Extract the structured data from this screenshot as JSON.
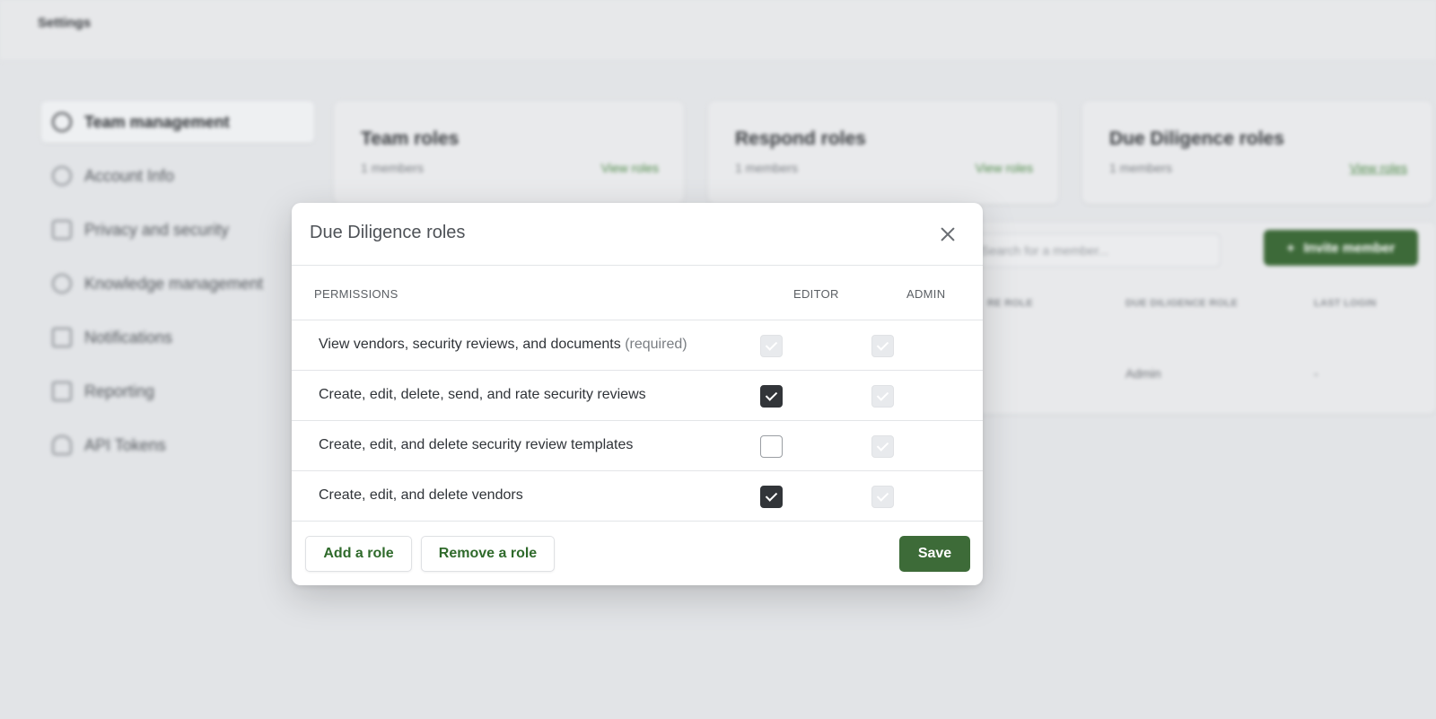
{
  "page": {
    "title": "Settings"
  },
  "sidebar": {
    "items": [
      {
        "label": "Team management",
        "icon": "users-icon"
      },
      {
        "label": "Account Info",
        "icon": "user-icon"
      },
      {
        "label": "Privacy and security",
        "icon": "lock-icon"
      },
      {
        "label": "Knowledge management",
        "icon": "globe-icon"
      },
      {
        "label": "Notifications",
        "icon": "notification-icon"
      },
      {
        "label": "Reporting",
        "icon": "report-icon"
      },
      {
        "label": "API Tokens",
        "icon": "cloud-icon"
      }
    ]
  },
  "cards": [
    {
      "title": "Team roles",
      "members": "1 members",
      "link": "View roles"
    },
    {
      "title": "Respond roles",
      "members": "1 members",
      "link": "View roles"
    },
    {
      "title": "Due Diligence roles",
      "members": "1 members",
      "link": "View roles"
    }
  ],
  "team_panel": {
    "search_placeholder": "Search for a member...",
    "invite_label": "Invite member",
    "columns": [
      "RE ROLE",
      "DUE DILIGENCE ROLE",
      "LAST LOGIN"
    ],
    "row": {
      "due_diligence_role": "Admin",
      "last_login": "-"
    }
  },
  "modal": {
    "title": "Due Diligence roles",
    "headers": {
      "permissions": "PERMISSIONS",
      "editor": "EDITOR",
      "admin": "ADMIN"
    },
    "permissions": [
      {
        "label": "View vendors, security reviews, and documents",
        "suffix": "(required)",
        "editor": "disabled-checked",
        "admin": "disabled-checked"
      },
      {
        "label": "Create, edit, delete, send, and rate security reviews",
        "suffix": "",
        "editor": "checked",
        "admin": "disabled-checked"
      },
      {
        "label": "Create, edit, and delete security review templates",
        "suffix": "",
        "editor": "unchecked",
        "admin": "disabled-checked"
      },
      {
        "label": "Create, edit, and delete vendors",
        "suffix": "",
        "editor": "checked",
        "admin": "disabled-checked"
      }
    ],
    "footer": {
      "add_label": "Add a role",
      "remove_label": "Remove a role",
      "save_label": "Save"
    }
  },
  "colors": {
    "accent": "#3d6b38",
    "link": "#2f6a2b",
    "checkbox_checked": "#323539"
  }
}
